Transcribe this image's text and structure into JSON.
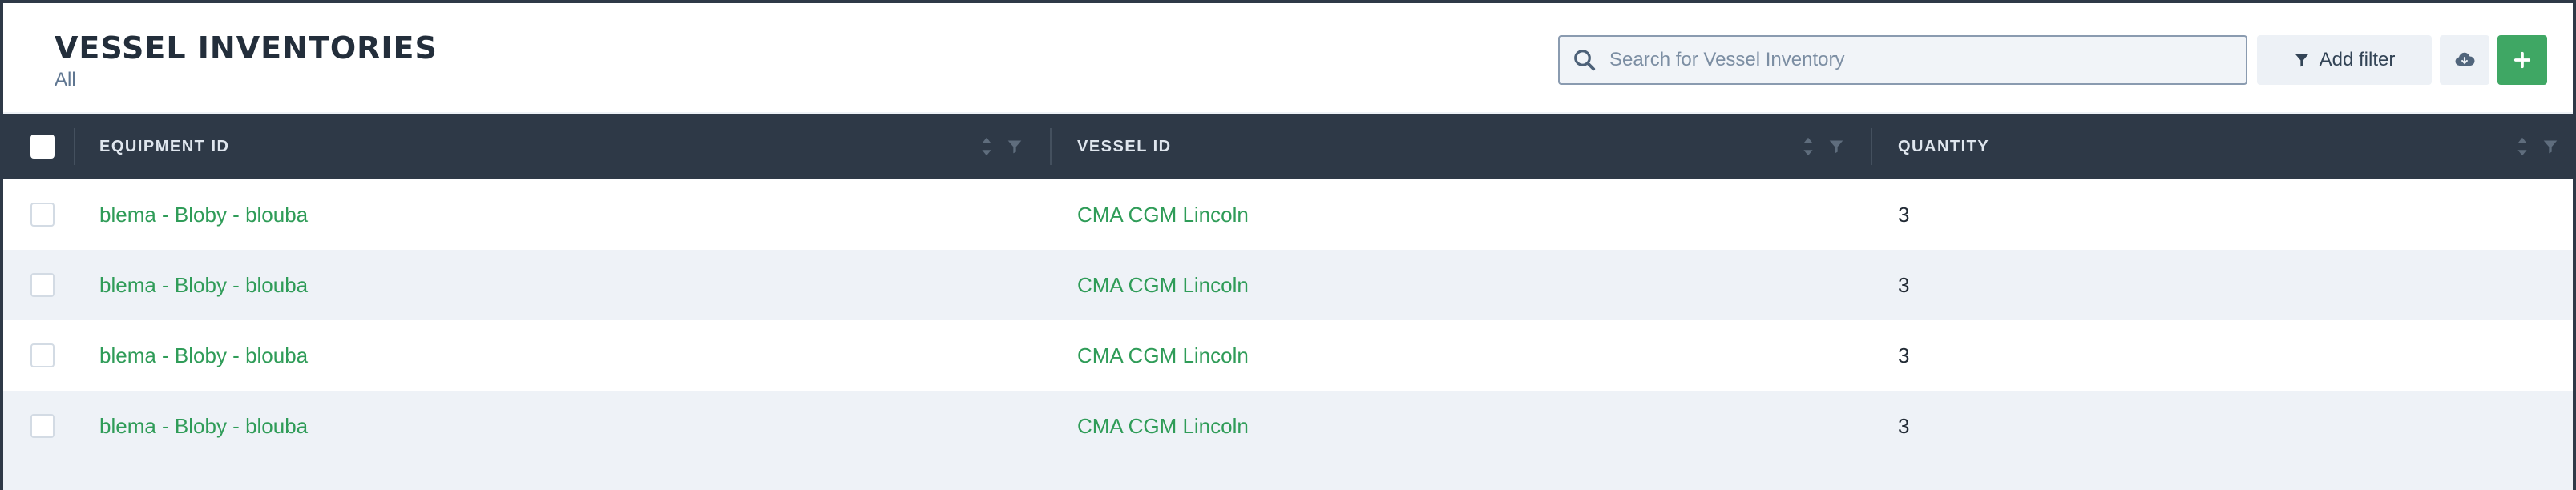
{
  "header": {
    "title": "VESSEL INVENTORIES",
    "subtitle": "All"
  },
  "search": {
    "placeholder": "Search for Vessel Inventory",
    "icon": "search-icon"
  },
  "toolbar": {
    "filter_label": "Add filter",
    "filter_icon": "funnel-icon",
    "download_icon": "cloud-download-icon",
    "add_icon": "plus-icon"
  },
  "colors": {
    "accent": "#3fa764",
    "link": "#2f9c58",
    "header_bg": "#2e3947"
  },
  "table": {
    "columns": [
      {
        "label": "EQUIPMENT ID"
      },
      {
        "label": "VESSEL ID"
      },
      {
        "label": "QUANTITY"
      }
    ],
    "rows": [
      {
        "equipment": "blema - Bloby - blouba",
        "vessel": "CMA CGM Lincoln",
        "quantity": "3"
      },
      {
        "equipment": "blema - Bloby - blouba",
        "vessel": "CMA CGM Lincoln",
        "quantity": "3"
      },
      {
        "equipment": "blema - Bloby - blouba",
        "vessel": "CMA CGM Lincoln",
        "quantity": "3"
      },
      {
        "equipment": "blema - Bloby - blouba",
        "vessel": "CMA CGM Lincoln",
        "quantity": "3"
      }
    ]
  }
}
